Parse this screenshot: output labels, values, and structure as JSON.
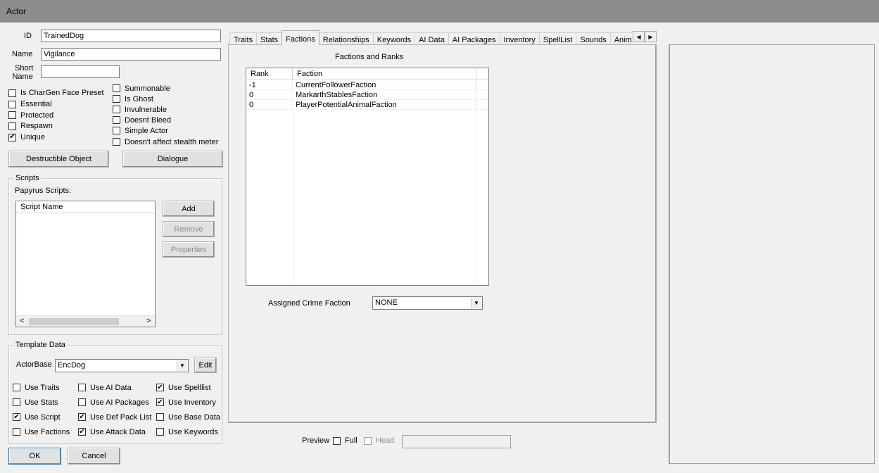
{
  "window": {
    "title": "Actor"
  },
  "identity": {
    "id_label": "ID",
    "id_value": "TrainedDog",
    "name_label": "Name",
    "name_value": "Vigilance",
    "short_label_1": "Short",
    "short_label_2": "Name",
    "short_value": ""
  },
  "flags_left": [
    {
      "label": "Is CharGen Face Preset",
      "checked": ""
    },
    {
      "label": "Essential",
      "checked": ""
    },
    {
      "label": "Protected",
      "checked": ""
    },
    {
      "label": "Respawn",
      "checked": ""
    },
    {
      "label": "Unique",
      "checked": "✔"
    }
  ],
  "flags_right": [
    {
      "label": "Summonable",
      "checked": ""
    },
    {
      "label": "Is Ghost",
      "checked": ""
    },
    {
      "label": "Invulnerable",
      "checked": ""
    },
    {
      "label": "Doesnt Bleed",
      "checked": ""
    },
    {
      "label": "Simple Actor",
      "checked": ""
    },
    {
      "label": "Doesn't affect stealth meter",
      "checked": ""
    }
  ],
  "buttons": {
    "destructible": "Destructible Object",
    "dialogue": "Dialogue",
    "ok": "OK",
    "cancel": "Cancel"
  },
  "scripts": {
    "group_title": "Scripts",
    "papyrus_label": "Papyrus Scripts:",
    "column": "Script Name",
    "add": "Add",
    "remove": "Remove",
    "properties": "Properties",
    "scroll_left": "<",
    "scroll_right": ">"
  },
  "template": {
    "group_title": "Template Data",
    "actorbase_label": "ActorBase",
    "actorbase_value": "EncDog",
    "edit": "Edit",
    "col1": [
      {
        "label": "Use Traits",
        "checked": ""
      },
      {
        "label": "Use Stats",
        "checked": ""
      },
      {
        "label": "Use Script",
        "checked": "✔"
      },
      {
        "label": "Use Factions",
        "checked": ""
      }
    ],
    "col2": [
      {
        "label": "Use AI Data",
        "checked": ""
      },
      {
        "label": "Use AI Packages",
        "checked": ""
      },
      {
        "label": "Use Def Pack List",
        "checked": "✔"
      },
      {
        "label": "Use Attack Data",
        "checked": "✔"
      }
    ],
    "col3": [
      {
        "label": "Use Spelllist",
        "checked": "✔"
      },
      {
        "label": "Use Inventory",
        "checked": "✔"
      },
      {
        "label": "Use Base Data",
        "checked": ""
      },
      {
        "label": "Use Keywords",
        "checked": ""
      }
    ]
  },
  "tabs": [
    {
      "label": "Traits",
      "name": "tab-traits"
    },
    {
      "label": "Stats",
      "name": "tab-stats"
    },
    {
      "label": "Factions",
      "name": "tab-factions"
    },
    {
      "label": "Relationships",
      "name": "tab-relationships"
    },
    {
      "label": "Keywords",
      "name": "tab-keywords"
    },
    {
      "label": "AI Data",
      "name": "tab-ai-data"
    },
    {
      "label": "AI Packages",
      "name": "tab-ai-packages"
    },
    {
      "label": "Inventory",
      "name": "tab-inventory"
    },
    {
      "label": "SpellList",
      "name": "tab-spelllist"
    },
    {
      "label": "Sounds",
      "name": "tab-sounds"
    },
    {
      "label": "Anim",
      "name": "tab-anim"
    }
  ],
  "factions": {
    "title": "Factions and Ranks",
    "col_rank": "Rank",
    "col_faction": "Faction",
    "rows": [
      {
        "rank": "-1",
        "faction": "CurrentFollowerFaction"
      },
      {
        "rank": "0",
        "faction": "MarkarthStablesFaction"
      },
      {
        "rank": "0",
        "faction": "PlayerPotentialAnimalFaction"
      }
    ],
    "crime_label": "Assigned Crime Faction",
    "crime_value": "NONE"
  },
  "preview": {
    "label": "Preview",
    "full": "Full",
    "head": "Head"
  }
}
